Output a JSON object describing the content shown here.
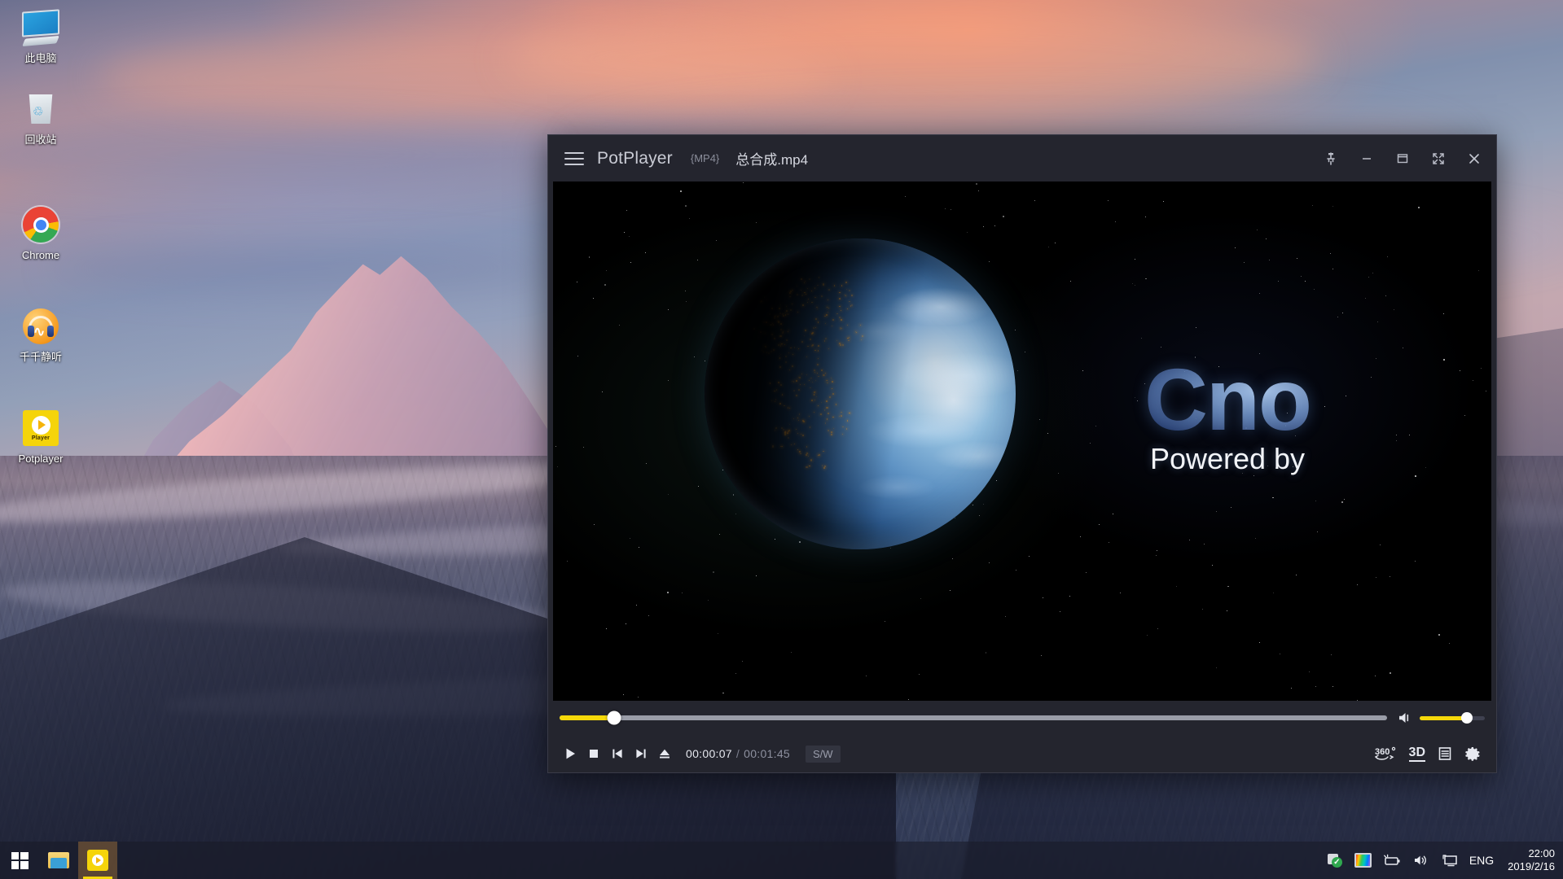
{
  "desktop": {
    "icons": [
      {
        "label": "此电脑",
        "icon": "this-pc-icon"
      },
      {
        "label": "回收站",
        "icon": "recycle-bin-icon"
      },
      {
        "label": "Chrome",
        "icon": "chrome-icon"
      },
      {
        "label": "千千静听",
        "icon": "ttplayer-icon"
      },
      {
        "label": "Potplayer",
        "icon": "potplayer-icon"
      }
    ]
  },
  "player": {
    "title_bar": {
      "menu_icon": "hamburger-menu-icon",
      "app_name": "PotPlayer",
      "format_tag": "{MP4}",
      "file_name": "总合成.mp4",
      "controls": [
        {
          "name": "pin-on-top-button",
          "icon": "pin-icon"
        },
        {
          "name": "minimize-button",
          "icon": "minimize-icon"
        },
        {
          "name": "maximize-button",
          "icon": "maximize-icon"
        },
        {
          "name": "fullscreen-button",
          "icon": "expand-icon"
        },
        {
          "name": "close-button",
          "icon": "close-icon"
        }
      ]
    },
    "video": {
      "overlay_title": "Cno",
      "overlay_subtitle": "Powered by"
    },
    "seek": {
      "percent": 6.6,
      "fill_color": "#f5d80a",
      "track_color": "#9a9da8"
    },
    "volume": {
      "percent": 72,
      "icon": "speaker-icon",
      "fill_color": "#f5d80a"
    },
    "transport": [
      {
        "name": "play-button",
        "icon": "play-icon"
      },
      {
        "name": "stop-button",
        "icon": "stop-icon"
      },
      {
        "name": "previous-button",
        "icon": "previous-icon"
      },
      {
        "name": "next-button",
        "icon": "next-icon"
      },
      {
        "name": "eject-button",
        "icon": "eject-icon"
      }
    ],
    "time": {
      "current": "00:00:07",
      "separator": "/",
      "total": "00:01:45"
    },
    "status_badge": "S/W",
    "right_tools": [
      {
        "name": "vr-360-button",
        "label": "360°"
      },
      {
        "name": "three-d-button",
        "label": "3D"
      },
      {
        "name": "playlist-button",
        "icon": "playlist-icon"
      },
      {
        "name": "settings-button",
        "icon": "gear-icon"
      }
    ]
  },
  "taskbar": {
    "start_label": "Start",
    "items": [
      {
        "name": "file-explorer",
        "icon": "folder-icon",
        "active": false
      },
      {
        "name": "potplayer",
        "icon": "potplayer-icon",
        "active": true
      }
    ],
    "tray": {
      "icons": [
        {
          "name": "security-icon"
        },
        {
          "name": "color-profile-icon"
        },
        {
          "name": "battery-icon"
        },
        {
          "name": "volume-icon"
        },
        {
          "name": "display-icon"
        }
      ],
      "language": "ENG",
      "time": "22:00",
      "date": "2019/2/16"
    }
  }
}
